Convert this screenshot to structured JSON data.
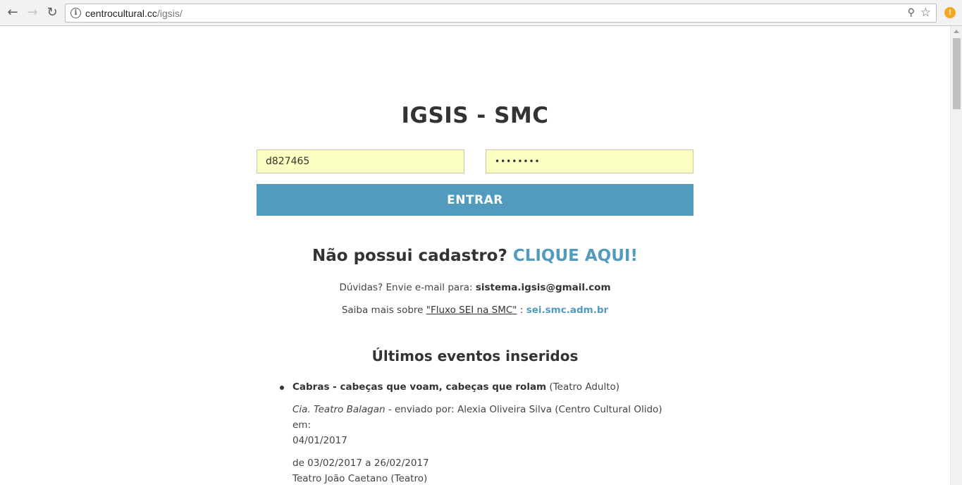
{
  "browser": {
    "url_host": "centrocultural.cc",
    "url_path": "/igsis/",
    "icons": {
      "back": "back-arrow-icon",
      "forward": "forward-arrow-icon",
      "reload": "reload-icon",
      "info": "info-icon",
      "key": "key-icon",
      "star": "star-icon",
      "extension": "alert-icon"
    }
  },
  "login": {
    "title": "IGSIS - SMC",
    "username_value": "d827465",
    "password_value": "••••••••",
    "submit_label": "ENTRAR"
  },
  "signup": {
    "question": "Não possui cadastro?",
    "link_label": "CLIQUE AQUI!"
  },
  "help": {
    "prefix": "Dúvidas? Envie e-mail para:",
    "email": "sistema.igsis@gmail.com",
    "sei_prefix": "Saiba mais sobre",
    "sei_link": "\"Fluxo SEI na SMC\"",
    "sei_separator": ":",
    "sei_site": "sei.smc.adm.br"
  },
  "events": {
    "title": "Últimos eventos inseridos",
    "items": [
      {
        "name": "Cabras - cabeças que voam, cabeças que rolam",
        "category": "(Teatro Adulto)",
        "company": "Cia. Teatro Balagan",
        "sent_by": "- enviado por: Alexia Oliveira Silva (Centro Cultural Olido) em:",
        "sent_date": "04/01/2017",
        "period": "de 03/02/2017 a 26/02/2017",
        "venue": "Teatro João Caetano (Teatro)"
      }
    ]
  },
  "colors": {
    "accent": "#519bbe",
    "input_bg": "#fbffc1",
    "text": "#333333"
  }
}
